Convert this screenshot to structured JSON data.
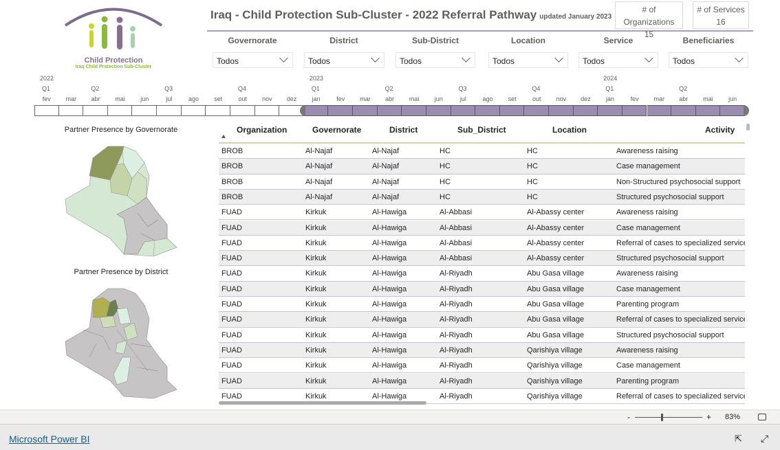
{
  "header": {
    "title": "Iraq - Child Protection Sub-Cluster - 2022 Referral Pathway",
    "subtitle": "updated January 2023"
  },
  "logo": {
    "line1": "Child Protection",
    "line2": "Iraq Child Protection Sub-Cluster"
  },
  "cards": [
    {
      "label": "# of Organizations",
      "value": "15"
    },
    {
      "label": "# of Services",
      "value": "16"
    }
  ],
  "filters": [
    {
      "label": "Governorate",
      "value": "Todos"
    },
    {
      "label": "District",
      "value": "Todos"
    },
    {
      "label": "Sub-District",
      "value": "Todos"
    },
    {
      "label": "Location",
      "value": "Todos"
    },
    {
      "label": "Service",
      "value": "Todos"
    },
    {
      "label": "Beneficiaries",
      "value": "Todos"
    }
  ],
  "timeline": {
    "years": [
      {
        "label": "2022",
        "start": 0
      },
      {
        "label": "2023",
        "start": 11
      },
      {
        "label": "2024",
        "start": 23
      }
    ],
    "quarters": [
      {
        "label": "Q1",
        "start": 0
      },
      {
        "label": "Q2",
        "start": 2
      },
      {
        "label": "Q3",
        "start": 5
      },
      {
        "label": "Q4",
        "start": 8
      },
      {
        "label": "Q1",
        "start": 11
      },
      {
        "label": "Q2",
        "start": 14
      },
      {
        "label": "Q3",
        "start": 17
      },
      {
        "label": "Q4",
        "start": 20
      },
      {
        "label": "Q1",
        "start": 23
      },
      {
        "label": "Q2",
        "start": 26
      }
    ],
    "months": [
      "fev",
      "mar",
      "abr",
      "mai",
      "jun",
      "jul",
      "ago",
      "set",
      "out",
      "nov",
      "dez",
      "jan",
      "fev",
      "mar",
      "abr",
      "mai",
      "jun",
      "jul",
      "ago",
      "set",
      "out",
      "nov",
      "dez",
      "jan",
      "fev",
      "mar",
      "abr",
      "mai",
      "jun"
    ],
    "selected_from": "jan 2023",
    "selected_to": "jun 2024",
    "selected_start_index": 11,
    "selected_color": "#9a8daf"
  },
  "maps": {
    "governorate_title": "Partner Presence by Governorate",
    "district_title": "Partner Presence by District"
  },
  "table": {
    "columns": [
      "Organization",
      "Governorate",
      "District",
      "Sub_District",
      "Location",
      "Activity"
    ],
    "rows": [
      [
        "BROB",
        "Al-Najaf",
        "Al-Najaf",
        "HC",
        "HC",
        "Awareness raising"
      ],
      [
        "BROB",
        "Al-Najaf",
        "Al-Najaf",
        "HC",
        "HC",
        "Case management"
      ],
      [
        "BROB",
        "Al-Najaf",
        "Al-Najaf",
        "HC",
        "HC",
        "Non-Structured psychosocial support"
      ],
      [
        "BROB",
        "Al-Najaf",
        "Al-Najaf",
        "HC",
        "HC",
        "Structured psychosocial support"
      ],
      [
        "FUAD",
        "Kirkuk",
        "Al-Hawiga",
        "Al-Abbasi",
        "Al-Abassy center",
        "Awareness raising"
      ],
      [
        "FUAD",
        "Kirkuk",
        "Al-Hawiga",
        "Al-Abbasi",
        "Al-Abassy center",
        "Case management"
      ],
      [
        "FUAD",
        "Kirkuk",
        "Al-Hawiga",
        "Al-Abbasi",
        "Al-Abassy center",
        "Referral of cases to specialized services"
      ],
      [
        "FUAD",
        "Kirkuk",
        "Al-Hawiga",
        "Al-Abbasi",
        "Al-Abassy center",
        "Structured psychosocial support"
      ],
      [
        "FUAD",
        "Kirkuk",
        "Al-Hawiga",
        "Al-Riyadh",
        "Abu Gasa village",
        "Awareness raising"
      ],
      [
        "FUAD",
        "Kirkuk",
        "Al-Hawiga",
        "Al-Riyadh",
        "Abu Gasa village",
        "Case management"
      ],
      [
        "FUAD",
        "Kirkuk",
        "Al-Hawiga",
        "Al-Riyadh",
        "Abu Gasa village",
        "Parenting program"
      ],
      [
        "FUAD",
        "Kirkuk",
        "Al-Hawiga",
        "Al-Riyadh",
        "Abu Gasa village",
        "Referral of cases to specialized services"
      ],
      [
        "FUAD",
        "Kirkuk",
        "Al-Hawiga",
        "Al-Riyadh",
        "Abu Gasa village",
        "Structured psychosocial support"
      ],
      [
        "FUAD",
        "Kirkuk",
        "Al-Hawiga",
        "Al-Riyadh",
        "Qarishiya village",
        "Awareness raising"
      ],
      [
        "FUAD",
        "Kirkuk",
        "Al-Hawiga",
        "Al-Riyadh",
        "Qarishiya village",
        "Case management"
      ],
      [
        "FUAD",
        "Kirkuk",
        "Al-Hawiga",
        "Al-Riyadh",
        "Qarishiya village",
        "Parenting program"
      ],
      [
        "FUAD",
        "Kirkuk",
        "Al-Hawiga",
        "Al-Riyadh",
        "Qarishiya village",
        "Referral of cases to specialized services"
      ]
    ]
  },
  "zoom": {
    "minus": "-",
    "plus": "+",
    "value": "83%",
    "level": 0.4
  },
  "footer": {
    "link": "Microsoft Power BI"
  }
}
